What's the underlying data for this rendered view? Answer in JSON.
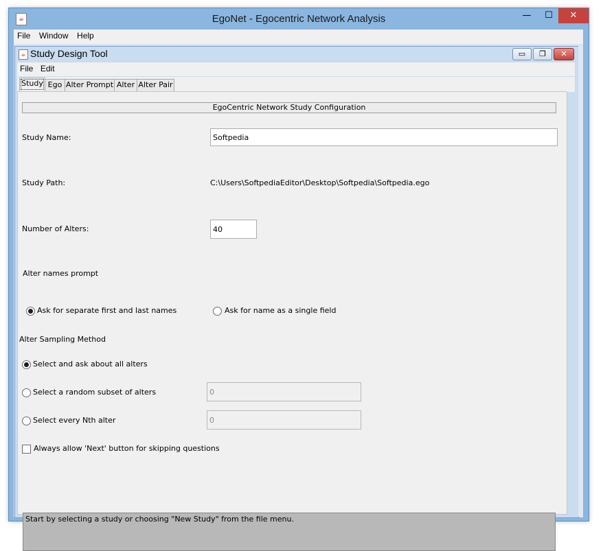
{
  "window": {
    "title": "EgoNet - Egocentric Network Analysis"
  },
  "menubar": {
    "items": [
      "File",
      "Window",
      "Help"
    ]
  },
  "internal_frame": {
    "title": "Study Design Tool",
    "menu": [
      "File",
      "Edit"
    ]
  },
  "tabs": [
    "Study",
    "Ego",
    "Alter Prompt",
    "Alter",
    "Alter Pair"
  ],
  "form": {
    "section_header": "EgoCentric Network Study Configuration",
    "study_name_label": "Study Name:",
    "study_name_value": "Softpedia",
    "study_path_label": "Study Path:",
    "study_path_value": "C:\\Users\\SoftpediaEditor\\Desktop\\Softpedia\\Softpedia.ego",
    "num_alters_label": "Number of Alters:",
    "num_alters_value": "40",
    "alter_names_prompt_label": "Alter names prompt",
    "radio_separate_names": "Ask for separate first and last names",
    "radio_single_field": "Ask for name as a single field",
    "sampling_label": "Alter Sampling Method",
    "radio_all_alters": "Select and ask about all alters",
    "radio_random_subset": "Select a random subset of alters",
    "random_subset_value": "0",
    "radio_every_nth": "Select every Nth alter",
    "every_nth_value": "0",
    "checkbox_next_button": "Always allow 'Next' button for skipping questions"
  },
  "status_text": "Start by selecting a study or choosing \"New Study\" from the file menu."
}
